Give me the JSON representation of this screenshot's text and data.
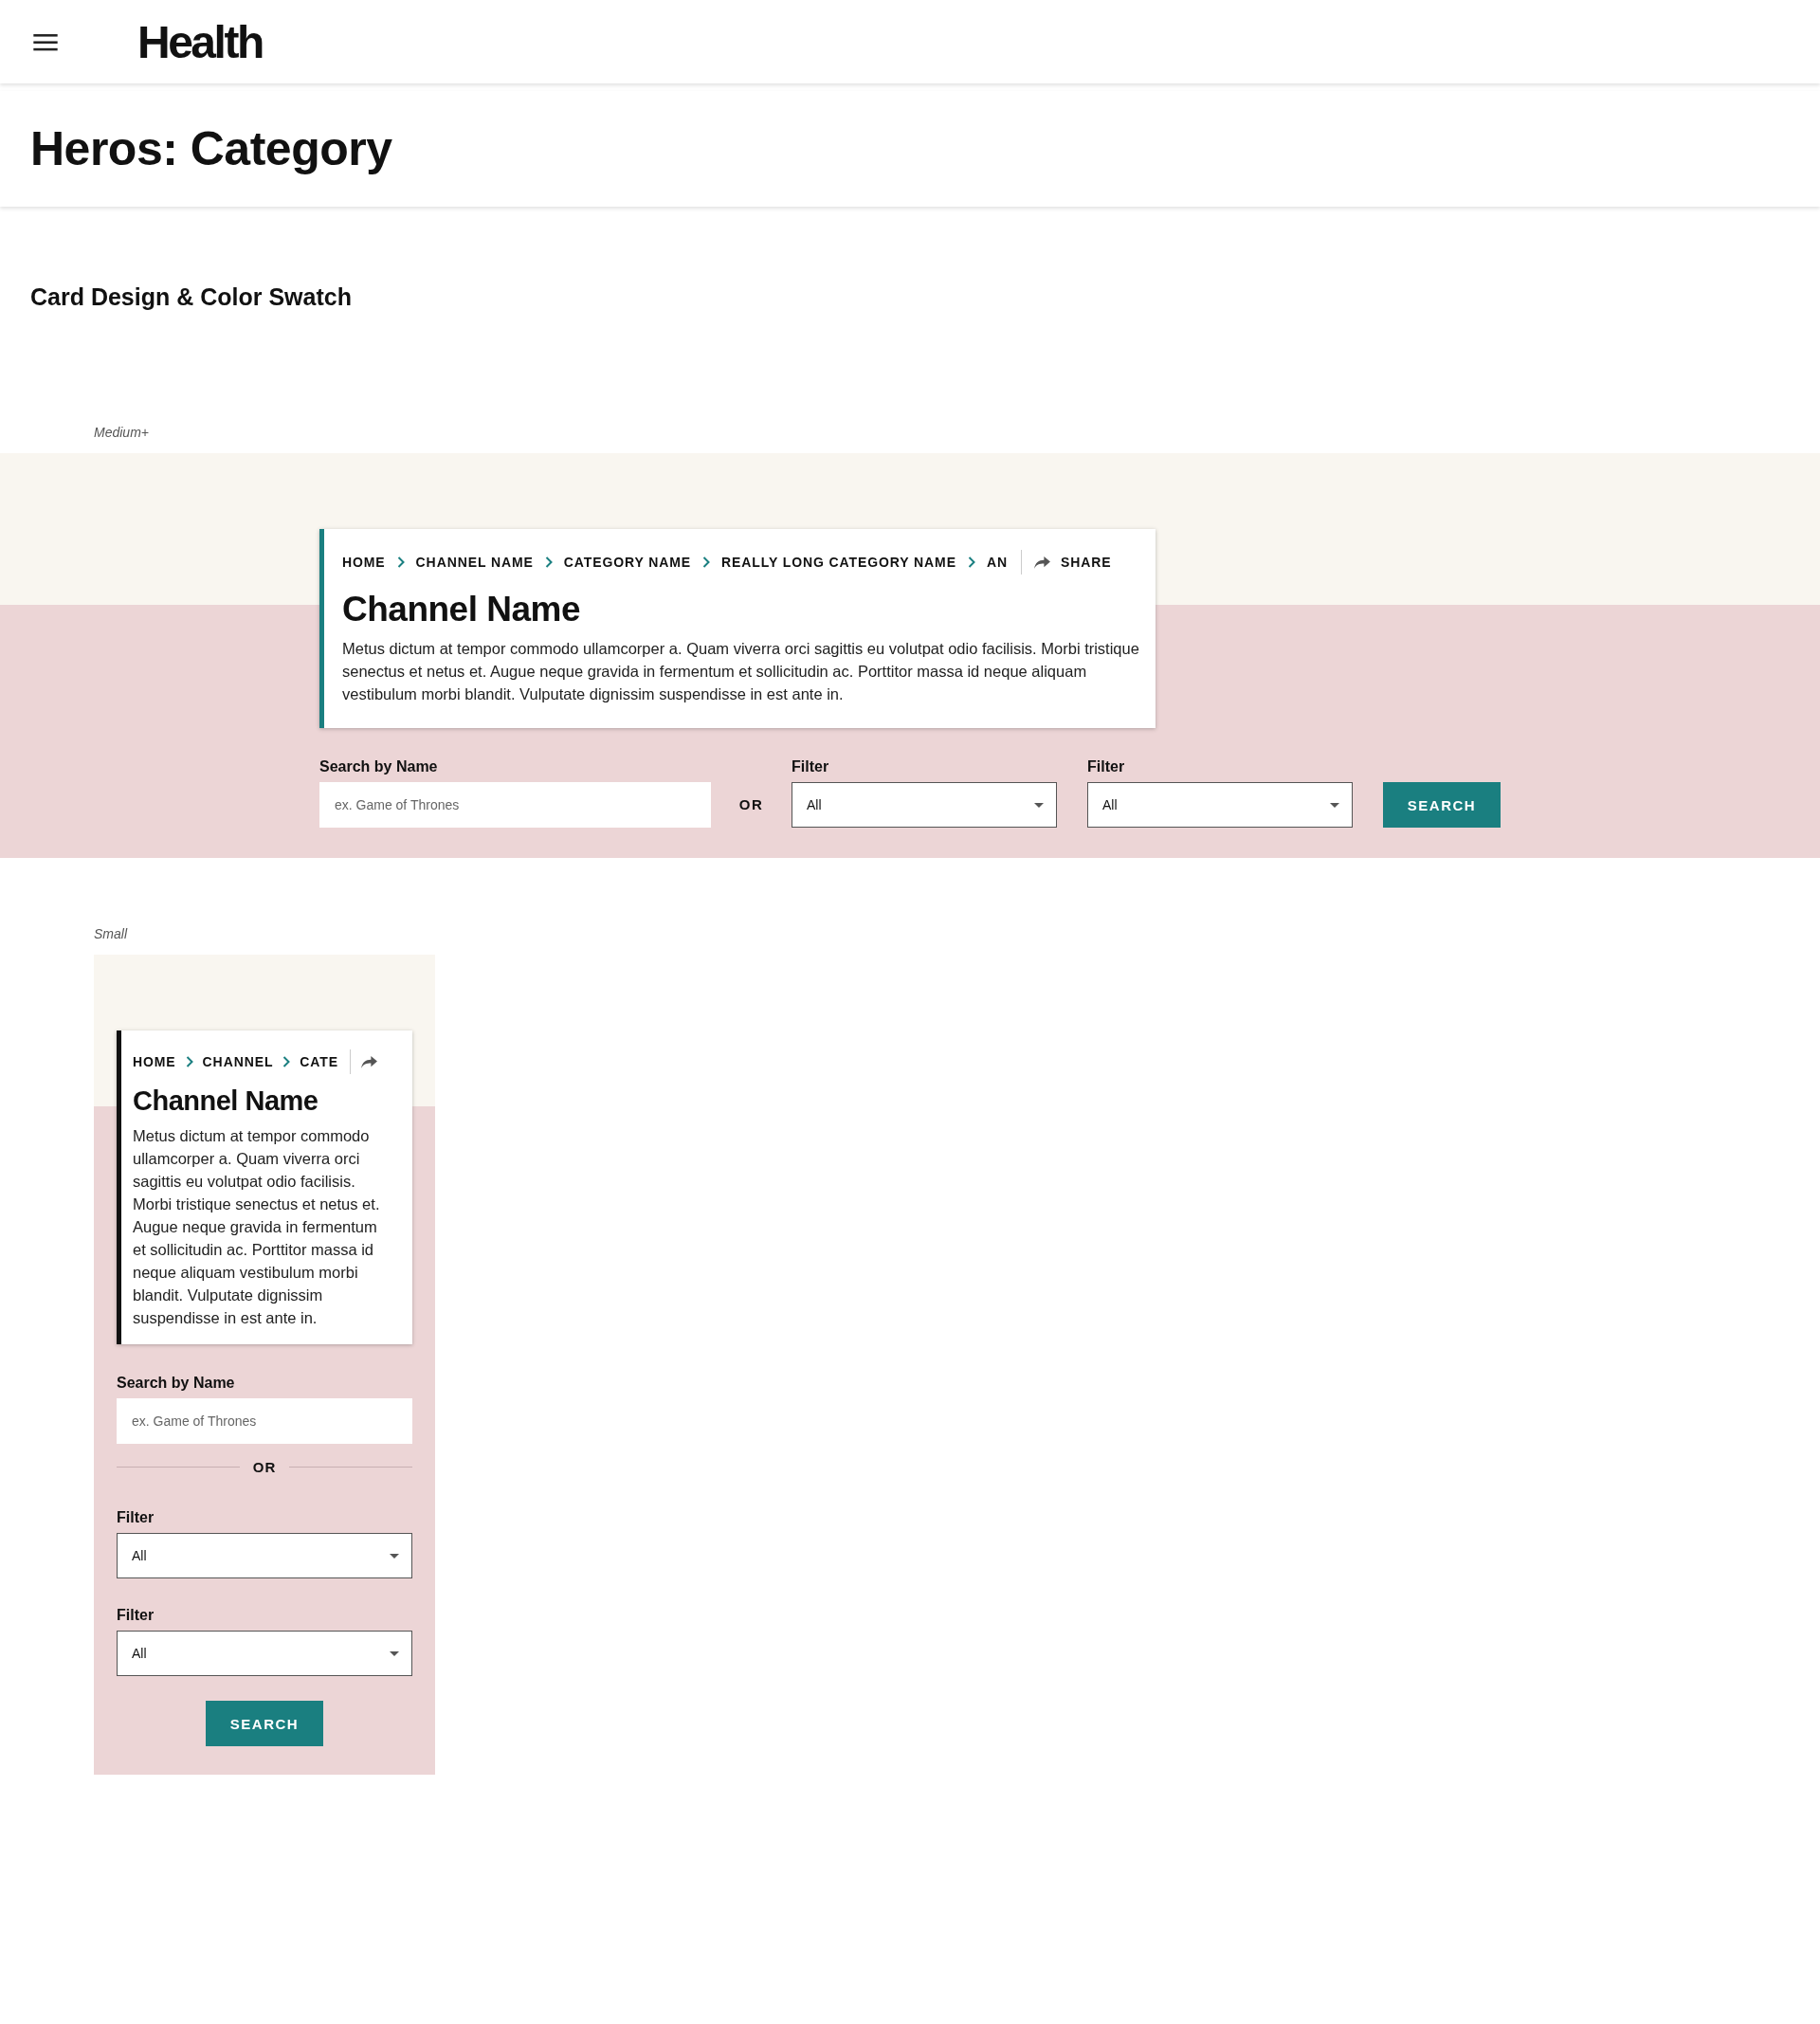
{
  "header": {
    "logo": "Health"
  },
  "page_title": "Heros: Category",
  "section_title": "Card Design & Color Swatch",
  "variants": [
    {
      "label": "Medium+",
      "kind": "wide",
      "color": "#1a7f80",
      "breadcrumbs": [
        "HOME",
        "CHANNEL NAME",
        "CATEGORY NAME",
        "REALLY LONG CATEGORY NAME",
        "AN"
      ],
      "share": "SHARE",
      "title": "Channel Name",
      "body": "Metus dictum at tempor commodo ullamcorper a. Quam viverra orci sagittis eu volutpat odio facilisis. Morbi tristique senectus et netus et. Augue neque gravida in fermentum et sollicitudin ac. Porttitor massa id neque aliquam vestibulum morbi blandit. Vulputate dignissim suspendisse in est ante in.",
      "search_label": "Search by Name",
      "placeholder": "ex. Game of Thrones",
      "or_label": "OR",
      "filters": [
        {
          "label": "Filter",
          "value": "All"
        },
        {
          "label": "Filter",
          "value": "All"
        }
      ],
      "button": "SEARCH"
    },
    {
      "label": "Small",
      "kind": "stacked",
      "color": "#111111",
      "breadcrumbs": [
        "HOME",
        "CHANNEL",
        "CATE"
      ],
      "title": "Channel Name",
      "body": "Metus dictum at tempor commodo ullamcorper a. Quam viverra orci sagittis eu volutpat odio facilisis. Morbi tristique senectus et netus et. Augue neque gravida in fermentum et sollicitudin ac. Porttitor massa id neque aliquam vestibulum morbi blandit. Vulputate dignissim suspendisse in est ante in.",
      "search_label": "Search by Name",
      "placeholder": "ex. Game of Thrones",
      "or_label": "OR",
      "filters": [
        {
          "label": "Filter",
          "value": "All"
        },
        {
          "label": "Filter",
          "value": "All"
        }
      ],
      "button": "SEARCH"
    }
  ]
}
